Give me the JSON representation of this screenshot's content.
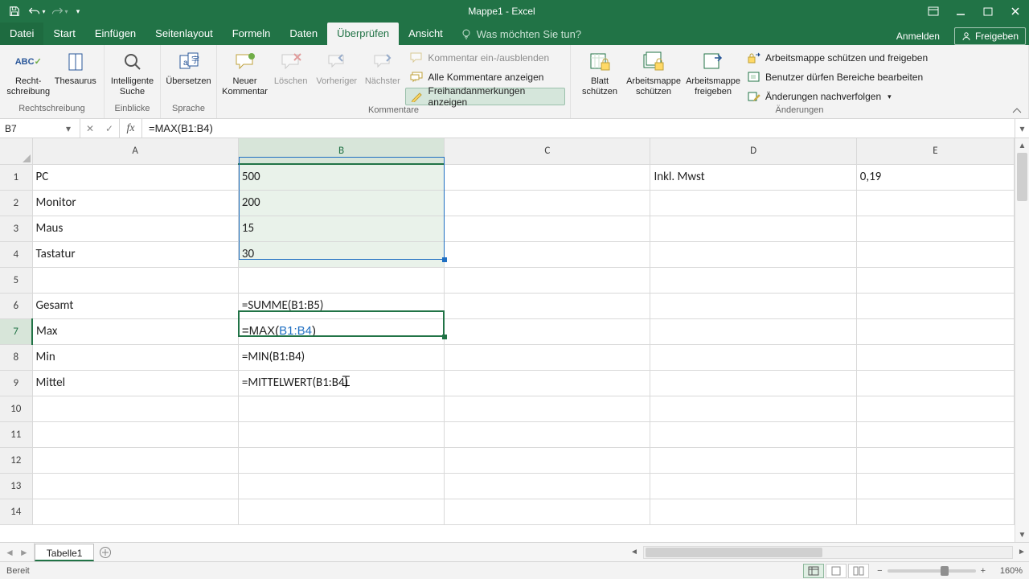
{
  "title": "Mappe1 - Excel",
  "tabs": {
    "file": "Datei",
    "items": [
      "Start",
      "Einfügen",
      "Seitenlayout",
      "Formeln",
      "Daten",
      "Überprüfen",
      "Ansicht"
    ],
    "active_index": 5,
    "tellme_placeholder": "Was möchten Sie tun?",
    "signin": "Anmelden",
    "share": "Freigeben"
  },
  "ribbon": {
    "groups": {
      "proofing": {
        "label": "Rechtschreibung",
        "spelling": "Recht-\nschreibung",
        "thesaurus": "Thesaurus"
      },
      "insights": {
        "label": "Einblicke",
        "smart": "Intelligente\nSuche"
      },
      "language": {
        "label": "Sprache",
        "translate": "Übersetzen"
      },
      "comments": {
        "label": "Kommentare",
        "new": "Neuer\nKommentar",
        "delete": "Löschen",
        "prev": "Vorheriger",
        "next": "Nächster",
        "toggle": "Kommentar ein-/ausblenden",
        "show_all": "Alle Kommentare anzeigen",
        "ink": "Freihandanmerkungen anzeigen"
      },
      "protect": {
        "label": "Änderungen",
        "sheet": "Blatt\nschützen",
        "workbook": "Arbeitsmappe\nschützen",
        "share_wb": "Arbeitsmappe\nfreigeben",
        "protect_share": "Arbeitsmappe schützen und freigeben",
        "allow_ranges": "Benutzer dürfen Bereiche bearbeiten",
        "track": "Änderungen nachverfolgen"
      }
    }
  },
  "formulabar": {
    "namebox": "B7",
    "formula": "=MAX(B1:B4)"
  },
  "columns": [
    "A",
    "B",
    "C",
    "D",
    "E"
  ],
  "row_numbers": [
    "1",
    "2",
    "3",
    "4",
    "5",
    "6",
    "7",
    "8",
    "9",
    "10",
    "11",
    "12",
    "13",
    "14"
  ],
  "cells": {
    "A1": "PC",
    "B1": "500",
    "D1": "Inkl. Mwst",
    "E1": "0,19",
    "A2": "Monitor",
    "B2": "200",
    "A3": "Maus",
    "B3": "15",
    "A4": "Tastatur",
    "B4": "30",
    "A6": "Gesamt",
    "B6": "=SUMME(B1:B5)",
    "A7": "Max",
    "B7": "=MAX(B1:B4)",
    "A8": "Min",
    "B8": "=MIN(B1:B4)",
    "A9": "Mittel",
    "B9": "=MITTELWERT(B1:B4)"
  },
  "b7_parts": {
    "pre": "=MAX(",
    "ref": "B1:B4",
    "post": ")"
  },
  "selection": {
    "active": "B7",
    "range": "B1:B4",
    "col_sel": "B",
    "row_sel": "7"
  },
  "sheet_tab": "Tabelle1",
  "status": {
    "ready": "Bereit",
    "zoom": "160%"
  }
}
